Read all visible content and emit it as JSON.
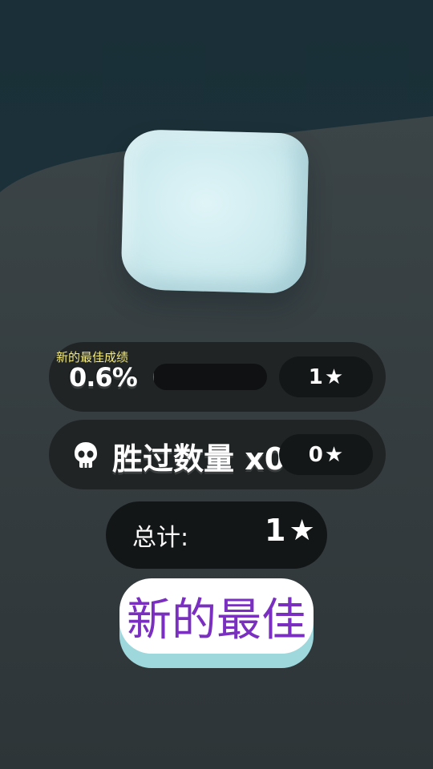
{
  "best_score": {
    "label": "新的最佳成绩",
    "percent": "0.6%",
    "progress": 0.006,
    "stars": "1"
  },
  "defeated": {
    "label": "胜过数量 x0",
    "stars": "0"
  },
  "total": {
    "label": "总计:",
    "stars": "1"
  },
  "new_best_button": {
    "label": "新的最佳"
  },
  "icons": {
    "star": "★",
    "skull": "skull-icon"
  },
  "colors": {
    "label_yellow": "#f3ea7a",
    "button_text_purple": "#7a2fc0",
    "progress_purple": "#7c3fc8"
  }
}
